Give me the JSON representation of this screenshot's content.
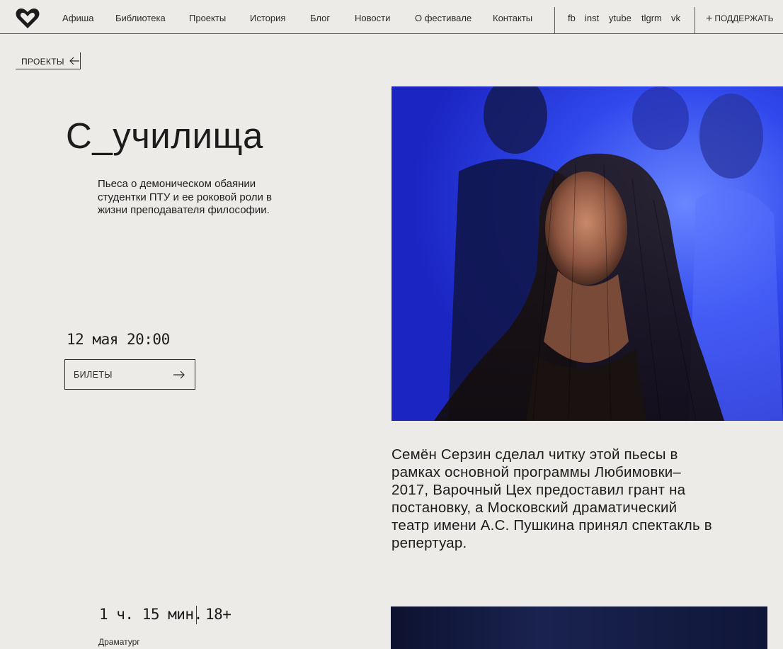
{
  "header": {
    "logo": "heart-logo",
    "nav": [
      {
        "label": "Афиша"
      },
      {
        "label": "Библиотека"
      },
      {
        "label": "Проекты"
      },
      {
        "label": "История"
      },
      {
        "label": "Блог"
      },
      {
        "label": "Новости"
      },
      {
        "label": "О фестивале"
      },
      {
        "label": "Контакты"
      }
    ],
    "social": [
      {
        "label": "fb"
      },
      {
        "label": "inst"
      },
      {
        "label": "ytube"
      },
      {
        "label": "tlgrm"
      },
      {
        "label": "vk"
      }
    ],
    "support_label": "ПОДДЕРЖАТЬ"
  },
  "breadcrumb": {
    "back_label": "ПРОЕКТЫ"
  },
  "project": {
    "title": "С_училища",
    "lead": "Пьеса о демоническом обаянии студентки ПТУ и ее роковой роли в жизни преподавателя философии.",
    "date": "12 мая 20:00",
    "tickets_label": "БИЛЕТЫ",
    "description": "Семён Серзин сделал читку этой пьесы в рамках основной программы Любимовки–2017, Варочный Цех предоставил грант на постановку, а Московский драматический театр имени А.С. Пушкина принял спектакль в репертуар.",
    "duration": "1 ч. 15 мин.",
    "age_rating": "18+",
    "credit_role": "Драматург"
  },
  "colors": {
    "background": "#ecebe8",
    "text": "#1c1c1c",
    "photo_accent": "#2b3cf0"
  }
}
